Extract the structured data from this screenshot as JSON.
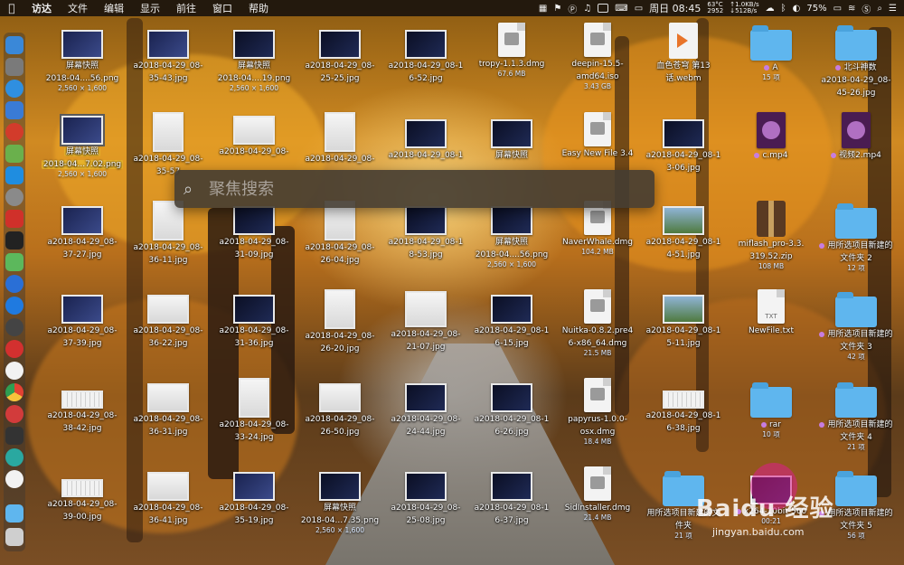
{
  "menubar": {
    "apple": "",
    "items": [
      "访达",
      "文件",
      "编辑",
      "显示",
      "前往",
      "窗口",
      "帮助"
    ],
    "cpu_temp": "63°C",
    "cpu_rpm": "2952",
    "net_up": "1.0KB/s",
    "net_down": "512B/s",
    "battery": "75%",
    "clock": "周日 08:45"
  },
  "spotlight": {
    "placeholder": "聚焦搜索"
  },
  "watermark": {
    "brand": "Baidu 经验",
    "url": "jingyan.baidu.com"
  },
  "icons": {
    "r1c1": {
      "name": "屏幕快照",
      "name2": "2018-04....56.png",
      "sub": "2,560 × 1,600"
    },
    "r1c2": {
      "name": "a2018-04-29_08-",
      "name2": "35-43.jpg"
    },
    "r1c3": {
      "name": "屏幕快照",
      "name2": "2018-04....19.png",
      "sub": "2,560 × 1,600"
    },
    "r1c4": {
      "name": "a2018-04-29_08-",
      "name2": "25-25.jpg"
    },
    "r1c5": {
      "name": "a2018-04-29_08-1",
      "name2": "6-52.jpg"
    },
    "r1c6": {
      "name": "tropy-1.1.3.dmg",
      "sub": "67.6 MB"
    },
    "r1c7": {
      "name": "deepin-15.5-",
      "name2": "amd64.iso",
      "sub": "3.43 GB"
    },
    "r1c8": {
      "name": "血色苍穹 第13",
      "name2": "话.webm"
    },
    "r1c9": {
      "name": "A",
      "sub": "15 项"
    },
    "r1c10": {
      "name": "北斗神数",
      "name2": "a2018-04-29_08-",
      "name3": "45-26.jpg"
    },
    "r2c1": {
      "name": "屏幕快照",
      "name2": "2018-04...7.02.png",
      "sub": "2,560 × 1,600"
    },
    "r2c2": {
      "name": "a2018-04-29_08-",
      "name2": "35-57"
    },
    "r2c3": {
      "name": "a2018-04-29_08-"
    },
    "r2c4": {
      "name": "a2018-04-29_08-"
    },
    "r2c5": {
      "name": "a2018-04-29_08-1"
    },
    "r2c6": {
      "name": "屏幕快照"
    },
    "r2c7": {
      "name": "Easy New File 3.4"
    },
    "r2c8": {
      "name": "a2018-04-29_08-1",
      "name2": "3-06.jpg"
    },
    "r2c9": {
      "name": "c.mp4"
    },
    "r2c10": {
      "name": "视频2.mp4"
    },
    "r3c1": {
      "name": "a2018-04-29_08-",
      "name2": "37-27.jpg"
    },
    "r3c2": {
      "name": "a2018-04-29_08-",
      "name2": "36-11.jpg"
    },
    "r3c3": {
      "name": "a2018-04-29_08-",
      "name2": "31-09.jpg"
    },
    "r3c4": {
      "name": "a2018-04-29_08-",
      "name2": "26-04.jpg"
    },
    "r3c5": {
      "name": "a2018-04-29_08-1",
      "name2": "8-53.jpg"
    },
    "r3c6": {
      "name": "屏幕快照",
      "name2": "2018-04....56.png",
      "sub": "2,560 × 1,600"
    },
    "r3c7": {
      "name": "NaverWhale.dmg",
      "sub": "104.2 MB"
    },
    "r3c8": {
      "name": "a2018-04-29_08-1",
      "name2": "4-51.jpg"
    },
    "r3c9": {
      "name": "miflash_pro-3.3.",
      "name2": "319.52.zip",
      "sub": "108 MB"
    },
    "r3c10": {
      "name": "用所选项目新建的",
      "name2": "文件夹 2",
      "sub": "12 项"
    },
    "r4c1": {
      "name": "a2018-04-29_08-",
      "name2": "37-39.jpg"
    },
    "r4c2": {
      "name": "a2018-04-29_08-",
      "name2": "36-22.jpg"
    },
    "r4c3": {
      "name": "a2018-04-29_08-",
      "name2": "31-36.jpg"
    },
    "r4c4": {
      "name": "a2018-04-29_08-",
      "name2": "26-20.jpg"
    },
    "r4c5": {
      "name": "a2018-04-29_08-",
      "name2": "21-07.jpg"
    },
    "r4c6": {
      "name": "a2018-04-29_08-1",
      "name2": "6-15.jpg"
    },
    "r4c7": {
      "name": "Nuitka-0.8.2.pre4",
      "name2": "6-x86_64.dmg",
      "sub": "21.5 MB"
    },
    "r4c8": {
      "name": "a2018-04-29_08-1",
      "name2": "5-11.jpg"
    },
    "r4c9": {
      "name": "NewFile.txt",
      "doc_label": "TXT"
    },
    "r4c10": {
      "name": "用所选项目新建的",
      "name2": "文件夹 3",
      "sub": "42 项"
    },
    "r5c1": {
      "name": "a2018-04-29_08-",
      "name2": "38-42.jpg"
    },
    "r5c2": {
      "name": "a2018-04-29_08-",
      "name2": "36-31.jpg"
    },
    "r5c3": {
      "name": "a2018-04-29_08-",
      "name2": "33-24.jpg"
    },
    "r5c4": {
      "name": "a2018-04-29_08-",
      "name2": "26-50.jpg"
    },
    "r5c5": {
      "name": "a2018-04-29_08-",
      "name2": "24-44.jpg"
    },
    "r5c6": {
      "name": "a2018-04-29_08-1",
      "name2": "6-26.jpg"
    },
    "r5c7": {
      "name": "papyrus-1.0.0-",
      "name2": "osx.dmg",
      "sub": "18.4 MB"
    },
    "r5c8": {
      "name": "a2018-04-29_08-1",
      "name2": "6-38.jpg"
    },
    "r5c9": {
      "name": "rar",
      "sub": "10 项"
    },
    "r5c10": {
      "name": "用所选项目新建的",
      "name2": "文件夹 4",
      "sub": "21 项"
    },
    "r6c1": {
      "name": "a2018-04-29_08-",
      "name2": "39-00.jpg"
    },
    "r6c2": {
      "name": "a2018-04-29_08-",
      "name2": "36-41.jpg"
    },
    "r6c3": {
      "name": "a2018-04-29_08-",
      "name2": "35-19.jpg"
    },
    "r6c4": {
      "name": "屏幕快照",
      "name2": "2018-04...7.35.png",
      "sub": "2,560 × 1,600"
    },
    "r6c5": {
      "name": "a2018-04-29_08-",
      "name2": "25-08.jpg"
    },
    "r6c6": {
      "name": "a2018-04-29_08-1",
      "name2": "6-37.jpg"
    },
    "r6c7": {
      "name": "SidInstaller.dmg",
      "sub": "21.4 MB"
    },
    "r6c8": {
      "name": "用所选项目新建的文",
      "name2": "件夹",
      "sub": "21 项"
    },
    "r6c9": {
      "name": "x264-10bit-560",
      "sub": "00:21"
    },
    "r6c10": {
      "name": "用所选项目新建的",
      "name2": "文件夹 5",
      "sub": "56 项"
    }
  }
}
